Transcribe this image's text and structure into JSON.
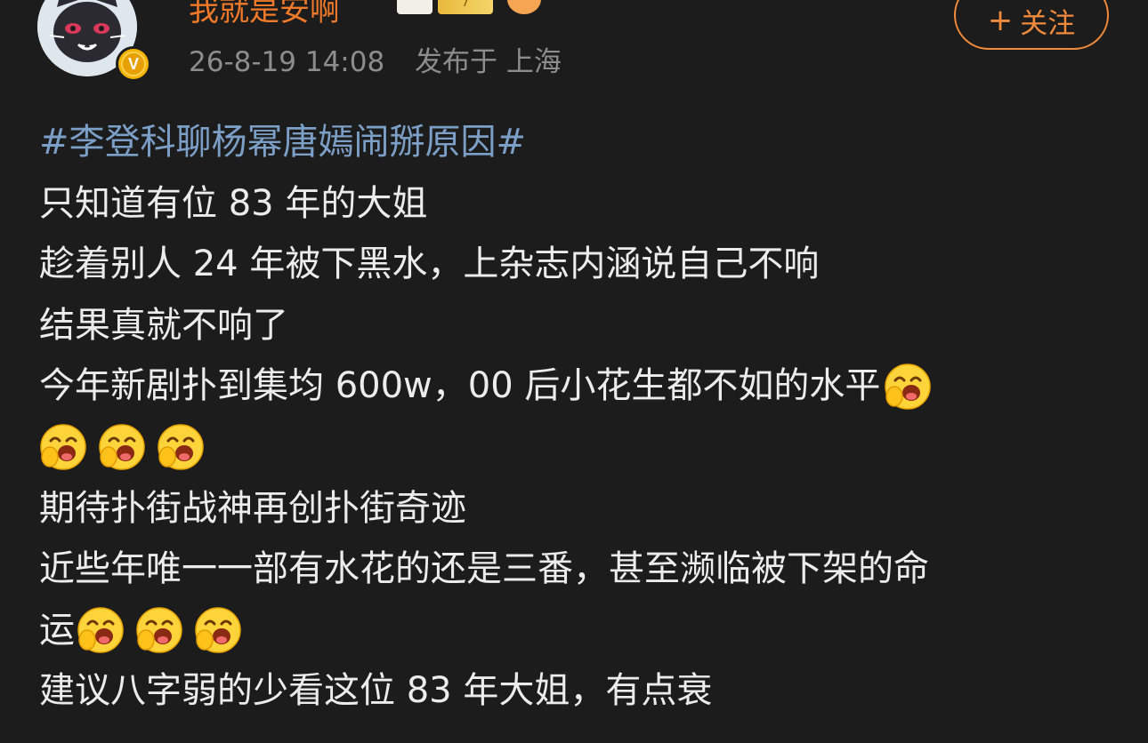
{
  "post": {
    "author": {
      "name": "我就是安啊",
      "badge_level": "7"
    },
    "meta": {
      "time": "26-8-19 14:08",
      "location": "发布于 上海"
    },
    "follow_button": {
      "plus": "+",
      "label": "关注"
    },
    "hashtag": "#李登科聊杨幂唐嫣闹掰原因#",
    "lines": [
      "只知道有位 83 年的大姐",
      "趁着别人 24 年被下黑水，上杂志内涵说自己不响",
      "结果真就不响了",
      "今年新剧扑到集均 600w，00 后小花生都不如的水平",
      "期待扑街战神再创扑街奇迹",
      "近些年唯一一部有水花的还是三番，甚至濒临被下架的命",
      "运",
      "建议八字弱的少看这位 83 年大姐，有点衰"
    ],
    "emoji_name": "laughing-cover-mouth-emoji"
  },
  "colors": {
    "background": "#1c1c1c",
    "username": "#f07a2a",
    "hashtag": "#7c9fc7",
    "follow_accent": "#f08a3c",
    "meta_text": "#8d8d8d",
    "body_text": "#ececec"
  }
}
